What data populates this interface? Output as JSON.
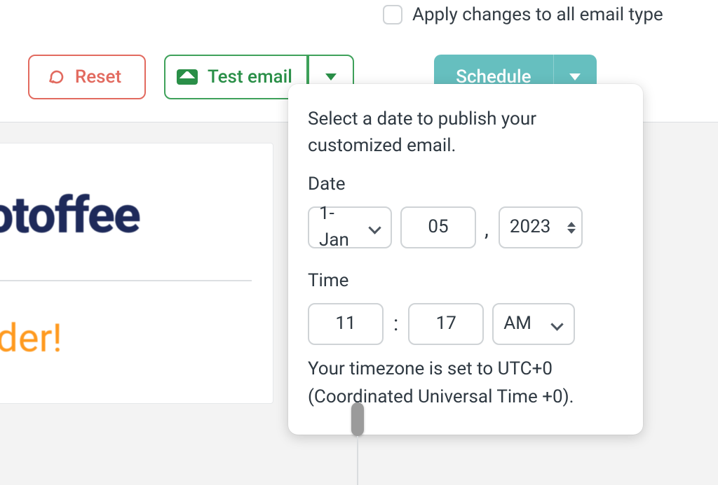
{
  "toolbar": {
    "apply_all_label": "Apply changes to all email type",
    "apply_all_checked": false,
    "reset_label": "Reset",
    "test_email_label": "Test email",
    "schedule_label": "Schedule"
  },
  "popover": {
    "description": "Select a date to publish your customized email.",
    "date_label": "Date",
    "month_value": "1-Jan",
    "day_value": "05",
    "year_value": "2023",
    "time_label": "Time",
    "hour_value": "11",
    "minute_value": "17",
    "meridiem_value": "AM",
    "timezone_line1": "Your timezone is set to UTC+0",
    "timezone_line2": "(Coordinated Universal Time +0)."
  },
  "preview": {
    "brand_fragment": "otoffee",
    "headline_fragment": "rder!"
  }
}
